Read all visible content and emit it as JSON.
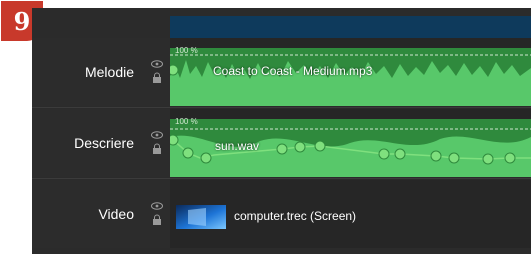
{
  "badge": {
    "text": "9",
    "color": "#c8392b"
  },
  "tracks": [
    {
      "name": "Melodie",
      "volume_label": "100 %",
      "clip_title": "Coast to Coast - Medium.mp3"
    },
    {
      "name": "Descriere",
      "volume_label": "100 %",
      "clip_title": "sun.wav"
    },
    {
      "name": "Video",
      "clip_title": "computer.trec (Screen)"
    }
  ],
  "icons": {
    "visibility": "eye-icon",
    "lock": "lock-icon",
    "thumbnail": "screen-thumbnail-icon"
  },
  "colors": {
    "audio_fill": "#58c86a",
    "audio_dark": "#2f8a3d",
    "volume_point": "#7fe07e",
    "top_bar": "#0e3a5c",
    "track_bg": "#262626"
  }
}
